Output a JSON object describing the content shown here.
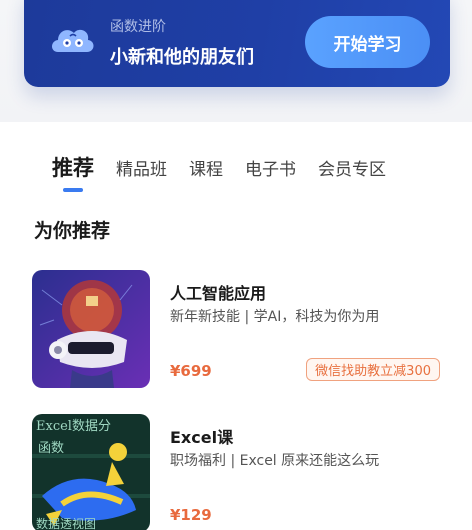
{
  "banner": {
    "subtitle": "函数进阶",
    "title": "小新和他的朋友们",
    "button_label": "开始学习"
  },
  "tabs": [
    {
      "label": "推荐",
      "active": true
    },
    {
      "label": "精品班",
      "active": false
    },
    {
      "label": "课程",
      "active": false
    },
    {
      "label": "电子书",
      "active": false
    },
    {
      "label": "会员专区",
      "active": false
    }
  ],
  "section_title": "为你推荐",
  "courses": [
    {
      "title": "人工智能应用",
      "description": "新年新技能 | 学AI，科技为你为用",
      "price": "¥699",
      "coupon": "微信找助教立减300"
    },
    {
      "title": "Excel课",
      "description": "职场福利 | Excel 原来还能这么玩",
      "price": "¥129",
      "thumb_text_1": "Excel数据分",
      "thumb_text_2": "函数",
      "thumb_text_3": "数据透视图"
    }
  ],
  "colors": {
    "banner": "#1f3fa6",
    "accent": "#3a7bf0",
    "price": "#e86a3e"
  }
}
